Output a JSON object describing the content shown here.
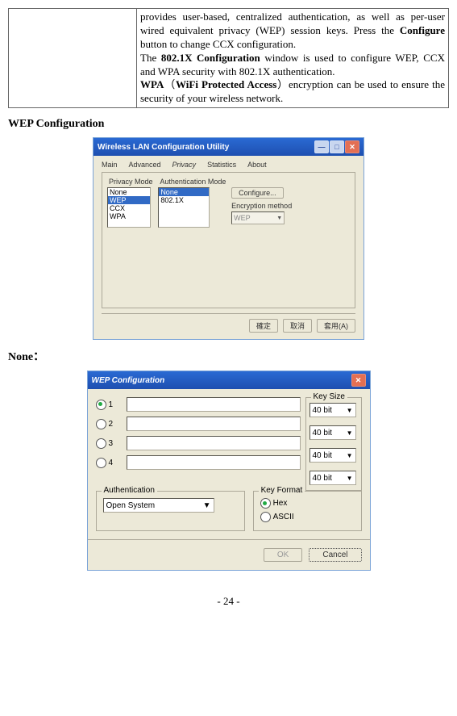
{
  "description": {
    "p1_pre": "provides user-based, centralized authentication, as well as per-user wired equivalent privacy (WEP) session keys. Press the ",
    "p1_bold": "Configure",
    "p1_post": " button to change CCX configuration.",
    "p2_pre": "The ",
    "p2_bold": "802.1X Configuration",
    "p2_post": " window is used to configure WEP, CCX and WPA security with 802.1X authentication.",
    "p3_bold": "WPA",
    "p3_mid1": "（",
    "p3_bold2": "WiFi Protected Access",
    "p3_mid2": "）encryption can be used to ensure the security of your wireless network."
  },
  "section_heading": "WEP Configuration",
  "section_sub": "None：",
  "window1": {
    "title": "Wireless LAN Configuration Utility",
    "tabs": [
      "Main",
      "Advanced",
      "Privacy",
      "Statistics",
      "About"
    ],
    "active_tab": "Privacy",
    "privacy_mode_label": "Privacy Mode",
    "auth_mode_label": "Authentication Mode",
    "privacy_items": [
      "None",
      "WEP",
      "CCX",
      "WPA"
    ],
    "privacy_selected": "WEP",
    "auth_items": [
      "None",
      "802.1X"
    ],
    "auth_selected": "None",
    "configure_btn": "Configure...",
    "enc_label": "Encryption method",
    "enc_value": "WEP",
    "ok": "確定",
    "cancel": "取消",
    "apply": "套用(A)"
  },
  "window2": {
    "title": "WEP Configuration",
    "key_size_label": "Key Size",
    "keys": [
      "1",
      "2",
      "3",
      "4"
    ],
    "key_size_value": "40 bit",
    "authentication_label": "Authentication",
    "authentication_value": "Open System",
    "key_format_label": "Key Format",
    "key_format_hex": "Hex",
    "key_format_ascii": "ASCII",
    "ok": "OK",
    "cancel": "Cancel"
  },
  "pager": "- 24 -"
}
